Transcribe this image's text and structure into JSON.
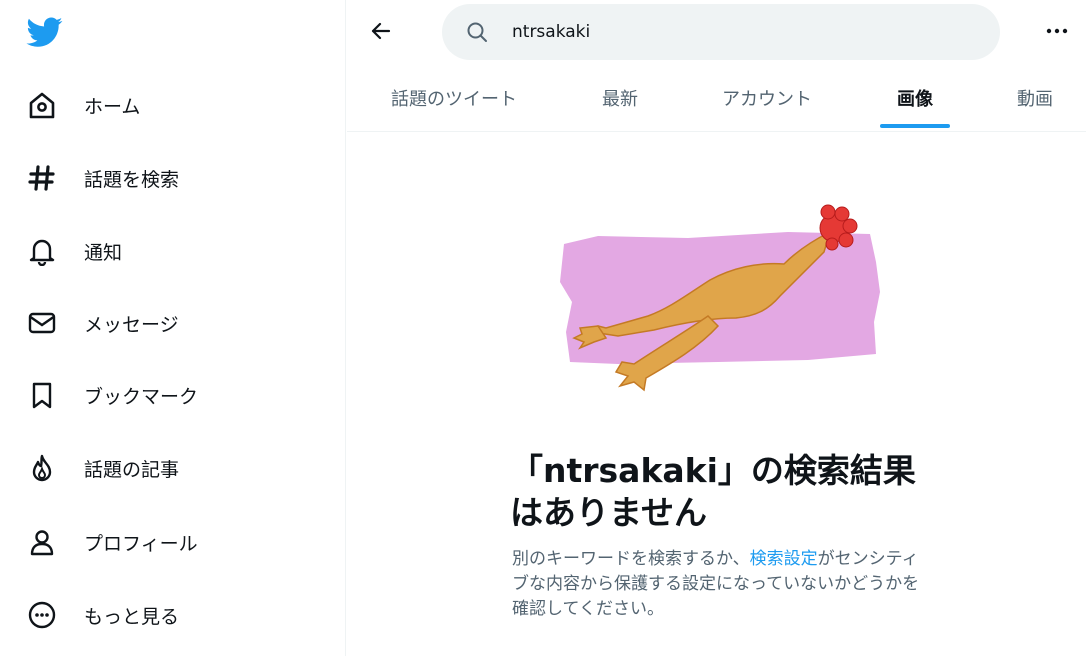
{
  "sidebar": {
    "items": [
      {
        "label": "ホーム",
        "icon": "home-icon"
      },
      {
        "label": "話題を検索",
        "icon": "hashtag-icon"
      },
      {
        "label": "通知",
        "icon": "bell-icon"
      },
      {
        "label": "メッセージ",
        "icon": "mail-icon"
      },
      {
        "label": "ブックマーク",
        "icon": "bookmark-icon"
      },
      {
        "label": "話題の記事",
        "icon": "flame-icon"
      },
      {
        "label": "プロフィール",
        "icon": "person-icon"
      },
      {
        "label": "もっと見る",
        "icon": "more-circle-icon"
      }
    ]
  },
  "search": {
    "value": "ntrsakaki"
  },
  "tabs": [
    {
      "label": "話題のツイート"
    },
    {
      "label": "最新"
    },
    {
      "label": "アカウント"
    },
    {
      "label": "画像",
      "active": true
    },
    {
      "label": "動画"
    }
  ],
  "empty_state": {
    "title": "「ntrsakaki」の検索結果はありません",
    "desc_before": "別のキーワードを検索するか、",
    "desc_link": "検索設定",
    "desc_after": "がセンシティブな内容から保護する設定になっていないかどうかを確認してください。"
  },
  "colors": {
    "accent": "#1d9bf0",
    "text_primary": "#0f1419",
    "text_secondary": "#536471",
    "search_bg": "#eff3f4",
    "illustration_bg": "#e3a8e3"
  }
}
